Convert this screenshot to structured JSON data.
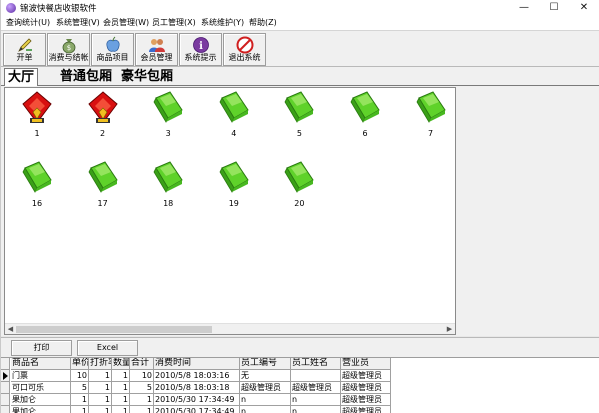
{
  "window": {
    "title": "锦波快餐店收银软件",
    "minimize": "—",
    "maximize": "☐",
    "close": "✕"
  },
  "menu": [
    "查询统计(U)",
    "系统管理(V)",
    "会员管理(W)",
    "员工管理(X)",
    "系统维护(Y)",
    "帮助(Z)"
  ],
  "toolbar": [
    {
      "label": "开单",
      "icon": "pen-icon"
    },
    {
      "label": "消费与结帐",
      "icon": "money-bag-icon"
    },
    {
      "label": "商品项目",
      "icon": "apple-icon"
    },
    {
      "label": "会员管理",
      "icon": "members-icon"
    },
    {
      "label": "系统提示",
      "icon": "info-icon"
    },
    {
      "label": "退出系统",
      "icon": "exit-icon"
    }
  ],
  "room_tabs": [
    "大厅",
    "普通包厢",
    "豪华包厢"
  ],
  "tables": [
    {
      "number": "1",
      "status": "occupied"
    },
    {
      "number": "2",
      "status": "occupied"
    },
    {
      "number": "3",
      "status": "free"
    },
    {
      "number": "4",
      "status": "free"
    },
    {
      "number": "5",
      "status": "free"
    },
    {
      "number": "6",
      "status": "free"
    },
    {
      "number": "7",
      "status": "free"
    },
    {
      "number": "16",
      "status": "free"
    },
    {
      "number": "17",
      "status": "free"
    },
    {
      "number": "18",
      "status": "free"
    },
    {
      "number": "19",
      "status": "free"
    },
    {
      "number": "20",
      "status": "free"
    }
  ],
  "actions": {
    "print": "打印",
    "excel": "Excel"
  },
  "bill": {
    "columns": [
      "商品名",
      "单价",
      "打折率",
      "数量",
      "合计",
      "消费时间",
      "员工编号",
      "员工姓名",
      "营业员"
    ],
    "rows": [
      [
        "门票",
        "10",
        "1",
        "1",
        "10",
        "2010/5/8  18:03:16",
        "无",
        "",
        "超级管理员"
      ],
      [
        "可口可乐",
        "5",
        "1",
        "1",
        "5",
        "2010/5/8  18:03:18",
        "超级管理员",
        "超级管理员",
        "超级管理员"
      ],
      [
        "果加仑",
        "1",
        "1",
        "1",
        "1",
        "2010/5/30  17:34:49",
        "n",
        "n",
        "超级管理员"
      ],
      [
        "果加仑",
        "1",
        "1",
        "1",
        "1",
        "2010/5/30  17:34:49",
        "n",
        "n",
        "超级管理员"
      ]
    ]
  },
  "colors": {
    "occupied": "#d81010",
    "free": "#5fd22a"
  }
}
